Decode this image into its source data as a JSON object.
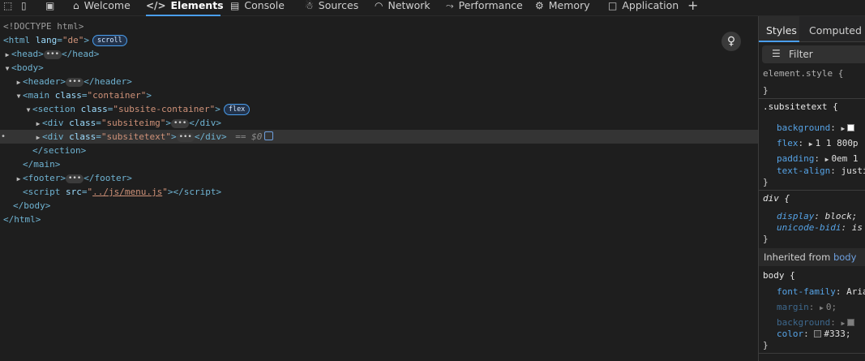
{
  "toolbar": {
    "tabs": [
      {
        "label": "Welcome",
        "icon": "home-icon"
      },
      {
        "label": "Elements",
        "icon": "code-icon"
      },
      {
        "label": "Console",
        "icon": "console-icon"
      },
      {
        "label": "Sources",
        "icon": "bug-icon"
      },
      {
        "label": "Network",
        "icon": "wifi-icon"
      },
      {
        "label": "Performance",
        "icon": "performance-icon"
      },
      {
        "label": "Memory",
        "icon": "memory-icon"
      },
      {
        "label": "Application",
        "icon": "application-icon"
      }
    ],
    "add_tab": "+"
  },
  "dom": {
    "doctype": "<!DOCTYPE html>",
    "html_open": "html",
    "html_lang_attr": "lang",
    "html_lang_val": "\"de\"",
    "badge_scroll": "scroll",
    "badge_flex": "flex",
    "head": "head",
    "body": "body",
    "header": "header",
    "main": "main",
    "main_class": "\"container\"",
    "section": "section",
    "section_class": "\"subsite-container\"",
    "div": "div",
    "div1_class": "\"subsiteimg\"",
    "div2_class": "\"subsitetext\"",
    "footer": "footer",
    "script": "script",
    "script_src": "../js/menu.js",
    "eq_dollar": "== $0",
    "attr_class": "class",
    "attr_src": "src"
  },
  "styles_pane": {
    "tabs": [
      "Styles",
      "Computed"
    ],
    "filter_placeholder": "Filter",
    "element_style": "element.style {",
    "close_brace": "}",
    "rule1_selector": ".subsitetext {",
    "rule1_props": [
      {
        "name": "background",
        "value": ""
      },
      {
        "name": "flex",
        "value": "1 1 800p"
      },
      {
        "name": "padding",
        "value": "0em 1"
      },
      {
        "name": "text-align",
        "value": "justi"
      }
    ],
    "rule2_selector": "div {",
    "rule2_props": [
      {
        "name": "display",
        "value": "block;"
      },
      {
        "name": "unicode-bidi",
        "value": "is"
      }
    ],
    "inherited_prefix": "Inherited from ",
    "inherited_from": "body",
    "rule3_selector": "body {",
    "rule3_props": [
      {
        "name": "font-family",
        "value": "Aria"
      },
      {
        "name": "margin",
        "value": "0;"
      },
      {
        "name": "background",
        "value": ""
      },
      {
        "name": "color",
        "value": "#333;"
      }
    ]
  },
  "colors": {
    "accent": "#4a9eed",
    "tag": "#6fb3d2",
    "attr_value": "#ce9178"
  }
}
